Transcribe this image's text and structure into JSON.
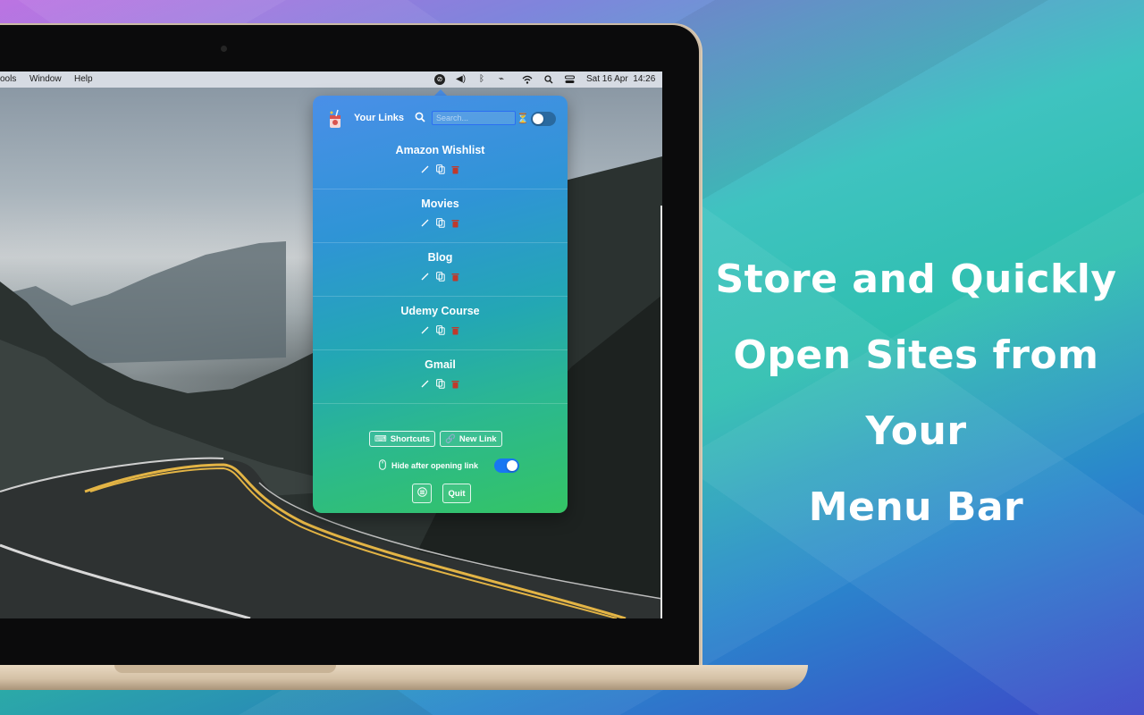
{
  "promo": {
    "line1": "Store and Quickly",
    "line2": "Open Sites from Your",
    "line3": "Menu Bar"
  },
  "menubar": {
    "items": [
      "ools",
      "Window",
      "Help"
    ],
    "datetime": "Sat 16 Apr  14:26"
  },
  "popover": {
    "title": "Your Links",
    "search_placeholder": "Search...",
    "links": [
      {
        "name": "Amazon Wishlist"
      },
      {
        "name": "Movies"
      },
      {
        "name": "Blog"
      },
      {
        "name": "Udemy Course"
      },
      {
        "name": "Gmail"
      }
    ],
    "buttons": {
      "shortcuts": "Shortcuts",
      "new_link": "New Link",
      "quit": "Quit"
    },
    "hide_after_opening_label": "Hide after opening link",
    "hide_after_opening_enabled": true,
    "header_toggle_enabled": false
  },
  "colors": {
    "accent": "#1877f2",
    "delete": "#c0392b"
  }
}
